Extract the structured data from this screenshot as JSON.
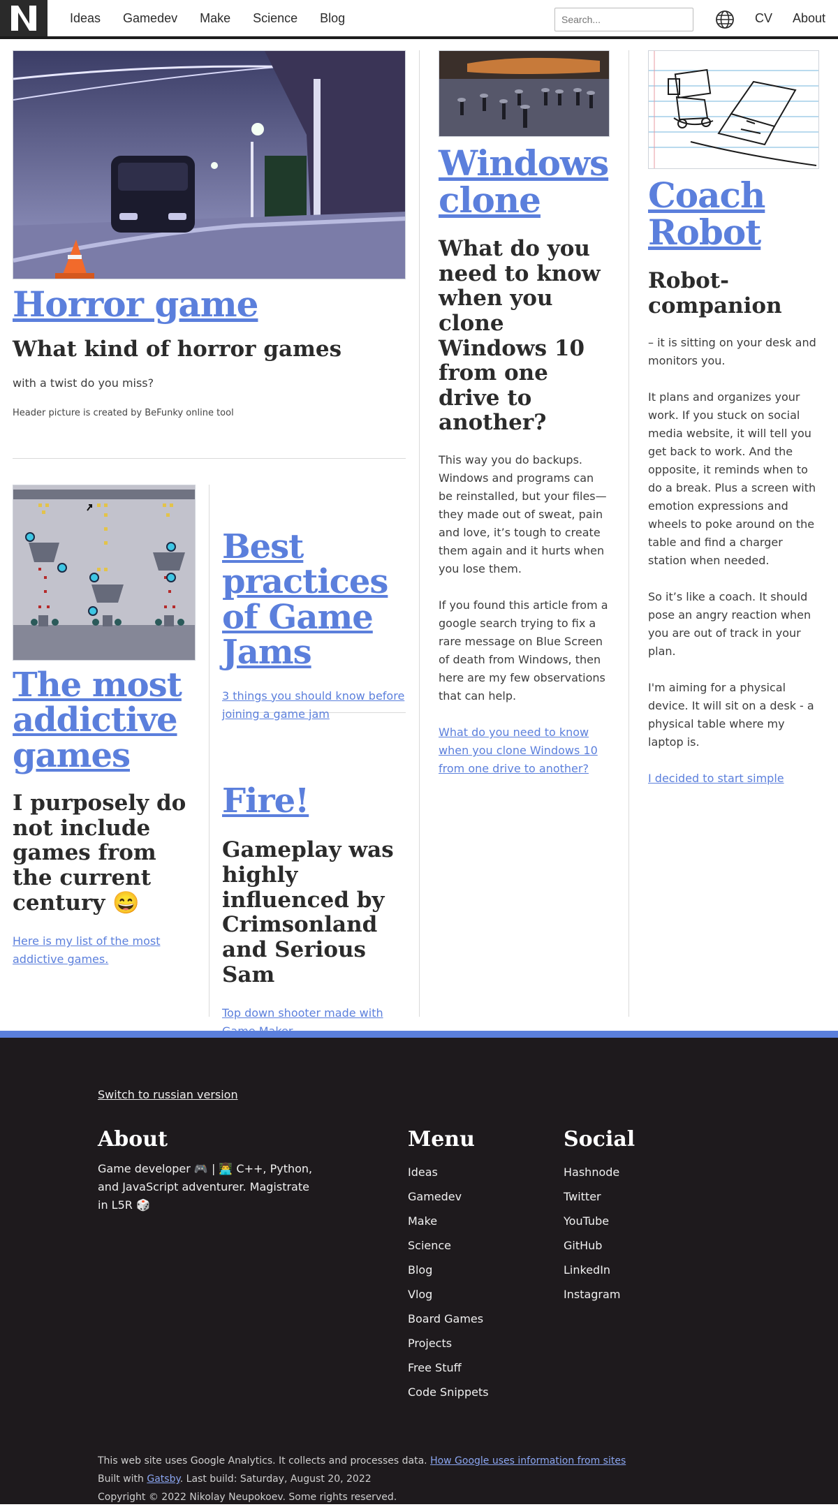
{
  "header": {
    "logo_text": "N",
    "nav": [
      "Ideas",
      "Gamedev",
      "Make",
      "Science",
      "Blog"
    ],
    "search_placeholder": "Search...",
    "cv_label": "CV",
    "about_label": "About"
  },
  "cards": {
    "horror": {
      "title": "Horror game",
      "subtitle": "What kind of horror games",
      "text": "with a twist do you miss?",
      "credit": "Header picture is created by BeFunky online tool"
    },
    "addictive": {
      "title": "The most addictive games",
      "subtitle": "I purposely do not include games from the current century 😄",
      "link": "Here is my list of the most addictive games."
    },
    "jams": {
      "title": "Best practices of Game Jams",
      "link": "3 things you should know before joining a game jam"
    },
    "fire": {
      "title": "Fire!",
      "subtitle": "Gameplay was highly influenced by Crimsonland and Serious Sam",
      "link": "Top down shooter made with Game Maker"
    },
    "windows": {
      "title": "Windows clone",
      "subtitle": "What do you need to know when you clone Windows 10 from one drive to another?",
      "p1": "This way you do backups. Windows and programs can be reinstalled, but your files—they made out of sweat, pain and love, it’s tough to create them again and it hurts when you lose them.",
      "p2": "If you found this article from a google search trying to fix a rare message on Blue Screen of death from Windows, then here are my few observations that can help.",
      "link": "What do you need to know when you clone Windows 10 from one drive to another?"
    },
    "robot": {
      "title": "Coach Robot",
      "subtitle": "Robot-companion",
      "p1": "– it is sitting on your desk and monitors you.",
      "p2": "It plans and organizes your work. If you stuck on social media website, it will tell you get back to work. And the opposite, it reminds when to do a break. Plus a screen with emotion expressions and wheels to poke around on the table and find a charger station when needed.",
      "p3": "So it’s like a coach. It should pose an angry reaction when you are out of track in your plan.",
      "p4": "I'm aiming for a physical device. It will sit on a desk - a physical table where my laptop is.",
      "link": "I decided to start simple"
    }
  },
  "footer": {
    "switch_language": "Switch to russian version",
    "about": {
      "heading": "About",
      "text": "Game developer 🎮 | 👨‍💻 C++, Python, and JavaScript adventurer. Magistrate in L5R 🎲"
    },
    "menu": {
      "heading": "Menu",
      "items": [
        "Ideas",
        "Gamedev",
        "Make",
        "Science",
        "Blog",
        "Vlog",
        "Board Games",
        "Projects",
        "Free Stuff",
        "Code Snippets"
      ]
    },
    "social": {
      "heading": "Social",
      "items": [
        "Hashnode",
        "Twitter",
        "YouTube",
        "GitHub",
        "LinkedIn",
        "Instagram"
      ]
    },
    "analytics_text": "This web site uses Google Analytics. It collects and processes data.",
    "analytics_link": "How Google uses information from sites",
    "built_prefix": "Built with",
    "built_link": "Gatsby",
    "built_suffix": ". Last build: Saturday, August 20, 2022",
    "copyright": "Copyright © 2022 Nikolay Neupokoev. Some rights reserved."
  },
  "colors": {
    "accent": "#5b7fdc",
    "footer_bg": "#1e1a1d",
    "text": "#2b2b2b"
  }
}
